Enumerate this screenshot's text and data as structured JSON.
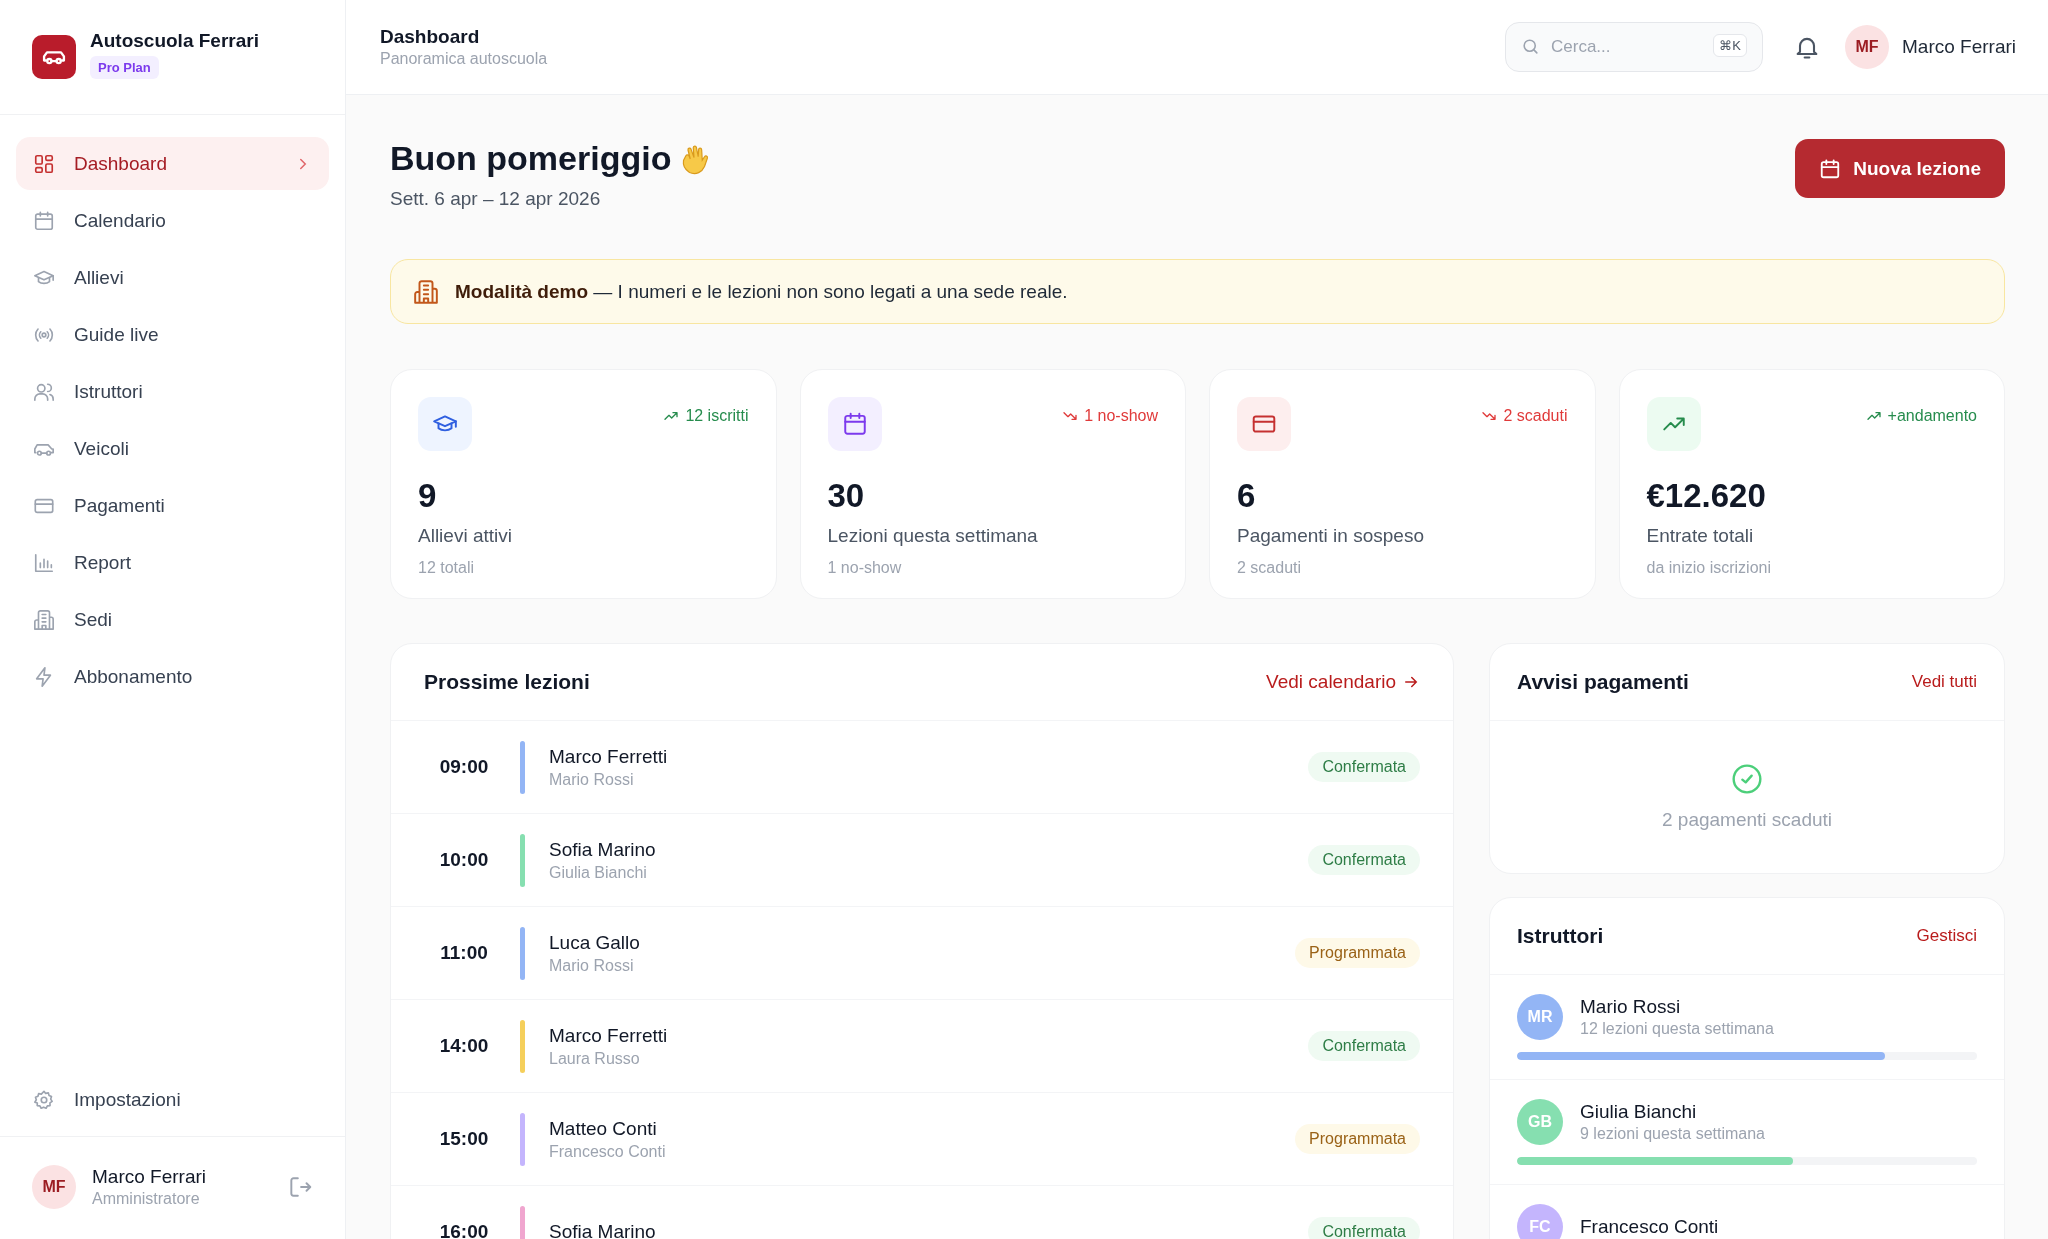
{
  "brand": {
    "name": "Autoscuola Ferrari",
    "plan": "Pro Plan"
  },
  "sidebar": {
    "items": [
      {
        "label": "Dashboard",
        "kind": "grid",
        "selected": true
      },
      {
        "label": "Calendario",
        "kind": "calendar",
        "selected": false
      },
      {
        "label": "Allievi",
        "kind": "cap",
        "selected": false
      },
      {
        "label": "Guide live",
        "kind": "radio",
        "selected": false
      },
      {
        "label": "Istruttori",
        "kind": "users",
        "selected": false
      },
      {
        "label": "Veicoli",
        "kind": "car",
        "selected": false
      },
      {
        "label": "Pagamenti",
        "kind": "card",
        "selected": false
      },
      {
        "label": "Report",
        "kind": "chart",
        "selected": false
      },
      {
        "label": "Sedi",
        "kind": "building",
        "selected": false
      },
      {
        "label": "Abbonamento",
        "kind": "bolt",
        "selected": false
      }
    ],
    "settings": {
      "label": "Impostazioni"
    },
    "user": {
      "initials": "MF",
      "name": "Marco Ferrari",
      "role": "Amministratore"
    }
  },
  "header": {
    "title": "Dashboard",
    "subtitle": "Panoramica autoscuola",
    "search": {
      "placeholder": "Cerca...",
      "shortcut": "⌘K"
    },
    "user": {
      "initials": "MF",
      "name": "Marco Ferrari"
    }
  },
  "greeting": {
    "title": "Buon pomeriggio",
    "subtitle": "Sett. 6 apr – 12 apr 2026",
    "button": "Nuova lezione"
  },
  "banner": {
    "bold": "Modalità demo",
    "text": "— I numeri e le lezioni non sono legati a una sede reale."
  },
  "stats": [
    {
      "kind": "cap",
      "rising": true,
      "trend_label": "12 iscritti",
      "value": "9",
      "label": "Allievi attivi",
      "note": "12 totali"
    },
    {
      "kind": "calendar",
      "rising": false,
      "trend_label": "1 no-show",
      "value": "30",
      "label": "Lezioni questa settimana",
      "note": "1 no-show"
    },
    {
      "kind": "card",
      "rising": false,
      "trend_label": "2 scaduti",
      "value": "6",
      "label": "Pagamenti in sospeso",
      "note": "2 scaduti"
    },
    {
      "kind": "trend",
      "rising": true,
      "trend_label": "+andamento",
      "value": "€12.620",
      "label": "Entrate totali",
      "note": "da inizio iscrizioni"
    }
  ],
  "lessons": {
    "title": "Prossime lezioni",
    "link": "Vedi calendario",
    "rows": [
      {
        "time": "09:00",
        "color": "#93b5f5",
        "student": "Marco Ferretti",
        "instructor": "Mario Rossi",
        "status": "Confermata",
        "kind": "confirmed"
      },
      {
        "time": "10:00",
        "color": "#86dfb0",
        "student": "Sofia Marino",
        "instructor": "Giulia Bianchi",
        "status": "Confermata",
        "kind": "confirmed"
      },
      {
        "time": "11:00",
        "color": "#93b5f5",
        "student": "Luca Gallo",
        "instructor": "Mario Rossi",
        "status": "Programmata",
        "kind": "scheduled"
      },
      {
        "time": "14:00",
        "color": "#f5cf5b",
        "student": "Marco Ferretti",
        "instructor": "Laura Russo",
        "status": "Confermata",
        "kind": "confirmed"
      },
      {
        "time": "15:00",
        "color": "#c4b5fd",
        "student": "Matteo Conti",
        "instructor": "Francesco Conti",
        "status": "Programmata",
        "kind": "scheduled"
      },
      {
        "time": "16:00",
        "color": "#f0a6cf",
        "student": "Sofia Marino",
        "status": "Confermata",
        "kind": "confirmed"
      }
    ]
  },
  "payments": {
    "title": "Avvisi pagamenti",
    "link": "Vedi tutti",
    "message": "2 pagamenti scaduti"
  },
  "instructors": {
    "title": "Istruttori",
    "link": "Gestisci",
    "items": [
      {
        "initials": "MR",
        "name": "Mario Rossi",
        "note": "12 lezioni questa settimana",
        "color": "#93b5f5",
        "level": 0.8
      },
      {
        "initials": "GB",
        "name": "Giulia Bianchi",
        "note": "9 lezioni questa settimana",
        "color": "#86dfb0",
        "level": 0.6
      },
      {
        "initials": "FC",
        "name": "Francesco Conti",
        "color": "#c4b5fd"
      }
    ]
  }
}
